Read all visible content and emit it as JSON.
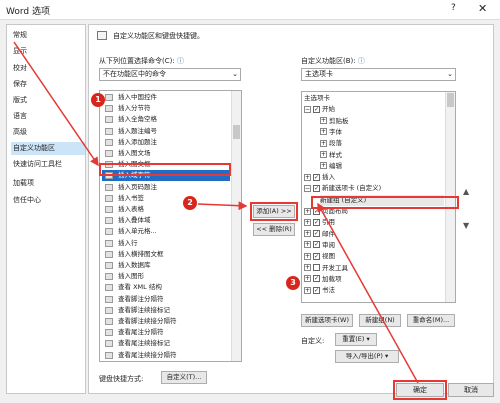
{
  "window": {
    "title": "Word 选项",
    "help": "?",
    "close": "✕"
  },
  "sidebar": {
    "items": [
      {
        "label": "常规"
      },
      {
        "label": "显示"
      },
      {
        "label": "校对"
      },
      {
        "label": "保存"
      },
      {
        "label": "版式"
      },
      {
        "label": "语言"
      },
      {
        "label": "高级"
      },
      {
        "label": "自定义功能区"
      },
      {
        "label": "快速访问工具栏"
      },
      {
        "label": "加载项"
      },
      {
        "label": "信任中心"
      }
    ],
    "active_index": 7
  },
  "main": {
    "heading": "自定义功能区和键盘快捷键。",
    "left": {
      "label": "从下列位置选择命令(C):",
      "info": "ⓘ",
      "combo_value": "不在功能区中的命令",
      "commands": [
        "插入中国控件",
        "插入分节符",
        "插入全角空格",
        "插入题注编号",
        "插入添加题注",
        "插入图文场",
        "插入图文框",
        "插入域字符",
        "插入页码题注",
        "插入书签",
        "插入表格",
        "插入叠体域",
        "插入单元格...",
        "插入行",
        "插入横排图文框",
        "插入数据库",
        "插入图形",
        "查看 XML 结构",
        "查看脚注分隔符",
        "查看脚注续接标记",
        "查看脚注续接分隔符",
        "查看尾注分隔符",
        "查看尾注续接标记",
        "查看尾注续接分隔符"
      ],
      "selected_index": 7
    },
    "add_button": "添加(A) >>",
    "remove_button": "<< 删除(R)",
    "right": {
      "label": "自定义功能区(B):",
      "info": "ⓘ",
      "combo_value": "主选项卡",
      "tree": [
        {
          "label": "主选项卡",
          "level": 0,
          "expander": "",
          "check": false
        },
        {
          "label": "开始",
          "level": 0,
          "expander": "⊟",
          "check": true
        },
        {
          "label": "剪贴板",
          "level": 1,
          "expander": "⊞",
          "check": false
        },
        {
          "label": "字体",
          "level": 1,
          "expander": "⊞",
          "check": false
        },
        {
          "label": "段落",
          "level": 1,
          "expander": "⊞",
          "check": false
        },
        {
          "label": "样式",
          "level": 1,
          "expander": "⊞",
          "check": false
        },
        {
          "label": "编辑",
          "level": 1,
          "expander": "⊞",
          "check": false
        },
        {
          "label": "插入",
          "level": 0,
          "expander": "⊞",
          "check": true
        },
        {
          "label": "新建选项卡 (自定义)",
          "level": 0,
          "expander": "⊟",
          "check": true
        },
        {
          "label": "新建组 (自定义)",
          "level": 1,
          "expander": "",
          "check": false
        },
        {
          "label": "页面布局",
          "level": 0,
          "expander": "⊞",
          "check": true
        },
        {
          "label": "引用",
          "level": 0,
          "expander": "⊞",
          "check": true
        },
        {
          "label": "邮件",
          "level": 0,
          "expander": "⊞",
          "check": true
        },
        {
          "label": "审阅",
          "level": 0,
          "expander": "⊞",
          "check": true
        },
        {
          "label": "视图",
          "level": 0,
          "expander": "⊞",
          "check": true
        },
        {
          "label": "开发工具",
          "level": 0,
          "expander": "⊞",
          "check": false
        },
        {
          "label": "加载项",
          "level": 0,
          "expander": "⊞",
          "check": true
        },
        {
          "label": "书法",
          "level": 0,
          "expander": "⊞",
          "check": true
        }
      ],
      "shaded_index": 9,
      "new_tab_button": "新建选项卡(W)",
      "new_group_button": "新建组(N)",
      "rename_button": "重命名(M)...",
      "customize_label": "自定义:",
      "reset_button": "重置(E) ▾",
      "import_export_button": "导入/导出(P) ▾"
    },
    "shortcut_label": "键盘快捷方式:",
    "customize_button": "自定义(T)...",
    "ok_button": "确定",
    "cancel_button": "取消"
  },
  "markers": [
    "1",
    "2",
    "3"
  ],
  "colors": {
    "accent_selection": "#1e6ec8",
    "annotation_red": "#e53935",
    "marker_red": "#d9261c"
  }
}
